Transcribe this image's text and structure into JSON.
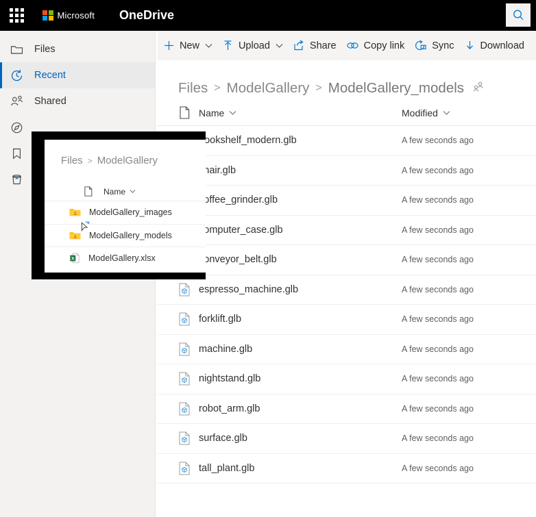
{
  "header": {
    "app_launcher": "app-launcher",
    "brand": "Microsoft",
    "app_name": "OneDrive",
    "search_label": "Search"
  },
  "command_bar": {
    "items": [
      {
        "label": "New",
        "icon": "plus-icon",
        "has_chevron": true
      },
      {
        "label": "Upload",
        "icon": "upload-arrow-icon",
        "has_chevron": true
      },
      {
        "label": "Share",
        "icon": "share-icon",
        "has_chevron": false
      },
      {
        "label": "Copy link",
        "icon": "link-icon",
        "has_chevron": false
      },
      {
        "label": "Sync",
        "icon": "sync-icon",
        "has_chevron": false
      },
      {
        "label": "Download",
        "icon": "download-arrow-icon",
        "has_chevron": false
      }
    ]
  },
  "sidebar": {
    "items": [
      {
        "label": "Files",
        "icon": "folder-icon",
        "selected": false
      },
      {
        "label": "Recent",
        "icon": "clock-icon",
        "selected": true
      },
      {
        "label": "Shared",
        "icon": "people-icon",
        "selected": false
      },
      {
        "label": "",
        "icon": "compass-icon",
        "selected": false
      },
      {
        "label": "",
        "icon": "bookmark-icon",
        "selected": false
      },
      {
        "label": "",
        "icon": "recycle-bin-icon",
        "selected": false
      }
    ]
  },
  "main": {
    "breadcrumb": {
      "items": [
        "Files",
        "ModelGallery",
        "ModelGallery_models"
      ],
      "separator": ">",
      "shared_icon": "people-shared-icon"
    },
    "columns": {
      "file_type": "file-type-icon",
      "name": "Name",
      "modified": "Modified"
    },
    "files": [
      {
        "name": "bookshelf_modern.glb",
        "modified": "A few seconds ago",
        "icon": "glb-3d-file-icon"
      },
      {
        "name": "chair.glb",
        "modified": "A few seconds ago",
        "icon": "glb-3d-file-icon"
      },
      {
        "name": "coffee_grinder.glb",
        "modified": "A few seconds ago",
        "icon": "glb-3d-file-icon"
      },
      {
        "name": "computer_case.glb",
        "modified": "A few seconds ago",
        "icon": "glb-3d-file-icon"
      },
      {
        "name": "conveyor_belt.glb",
        "modified": "A few seconds ago",
        "icon": "glb-3d-file-icon"
      },
      {
        "name": "espresso_machine.glb",
        "modified": "A few seconds ago",
        "icon": "glb-3d-file-icon"
      },
      {
        "name": "forklift.glb",
        "modified": "A few seconds ago",
        "icon": "glb-3d-file-icon"
      },
      {
        "name": "machine.glb",
        "modified": "A few seconds ago",
        "icon": "glb-3d-file-icon"
      },
      {
        "name": "nightstand.glb",
        "modified": "A few seconds ago",
        "icon": "glb-3d-file-icon"
      },
      {
        "name": "robot_arm.glb",
        "modified": "A few seconds ago",
        "icon": "glb-3d-file-icon"
      },
      {
        "name": "surface.glb",
        "modified": "A few seconds ago",
        "icon": "glb-3d-file-icon"
      },
      {
        "name": "tall_plant.glb",
        "modified": "A few seconds ago",
        "icon": "glb-3d-file-icon"
      }
    ]
  },
  "inset": {
    "breadcrumb": {
      "items": [
        "Files",
        "ModelGallery"
      ],
      "separator": ">"
    },
    "column_name": "Name",
    "rows": [
      {
        "name": "ModelGallery_images",
        "icon": "shared-folder-icon"
      },
      {
        "name": "ModelGallery_models",
        "icon": "shared-folder-icon",
        "cursor": "busy-cursor"
      },
      {
        "name": "ModelGallery.xlsx",
        "icon": "excel-file-icon"
      }
    ]
  },
  "colors": {
    "header_bg": "#000000",
    "accent_blue": "#0078d4",
    "sidebar_bg": "#f3f2f1",
    "selected_bg": "#eaeaea",
    "selected_text": "#0064bd",
    "folder_yellow": "#ffb900",
    "excel_green": "#217346"
  }
}
